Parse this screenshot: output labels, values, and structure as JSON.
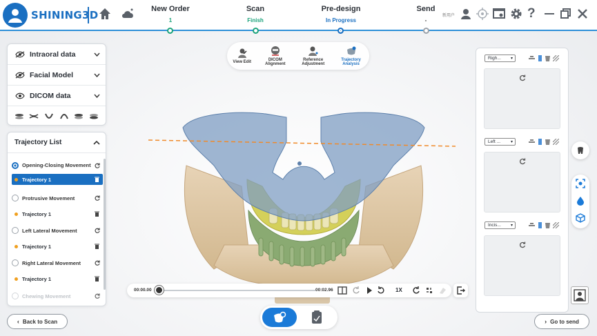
{
  "app": {
    "brand": "SHINING3D",
    "user_tag": "新用户"
  },
  "workflow": {
    "steps": [
      {
        "title": "New Order",
        "status": "1"
      },
      {
        "title": "Scan",
        "status": "Finish"
      },
      {
        "title": "Pre-design",
        "status": "In Progress"
      },
      {
        "title": "Send",
        "status": "-"
      }
    ]
  },
  "left_panel": {
    "data_rows": [
      {
        "label": "Intraoral data"
      },
      {
        "label": "Facial Model"
      },
      {
        "label": "DICOM data"
      }
    ]
  },
  "trajectory": {
    "title": "Trajectory List",
    "movements": [
      {
        "label": "Opening-Closing Movement",
        "sub": "Trajectory 1"
      },
      {
        "label": "Protrusive Movement",
        "sub": "Trajectory 1"
      },
      {
        "label": "Left Lateral Movement",
        "sub": "Trajectory 1"
      },
      {
        "label": "Right Lateral Movement",
        "sub": "Trajectory 1"
      },
      {
        "label": "Chewing Movement"
      }
    ]
  },
  "tools": [
    {
      "label": "View Edit"
    },
    {
      "label": "DICOM Alignment"
    },
    {
      "label": "Reference Adjustment"
    },
    {
      "label": "Trajectory Analysis"
    }
  ],
  "playback": {
    "current": "00:00.00",
    "total": "00:02.96",
    "speed": "1X"
  },
  "right_panel": {
    "views": [
      {
        "label": "Righ..."
      },
      {
        "label": "Left ..."
      },
      {
        "label": "Incis..."
      }
    ]
  },
  "buttons": {
    "back": "Back to Scan",
    "send": "Go to send"
  },
  "colors": {
    "accent": "#1a6fc1",
    "finish": "#1aa27a",
    "trajectory_dot": "#f0a020",
    "occlusal_line": "#f08a2a"
  }
}
